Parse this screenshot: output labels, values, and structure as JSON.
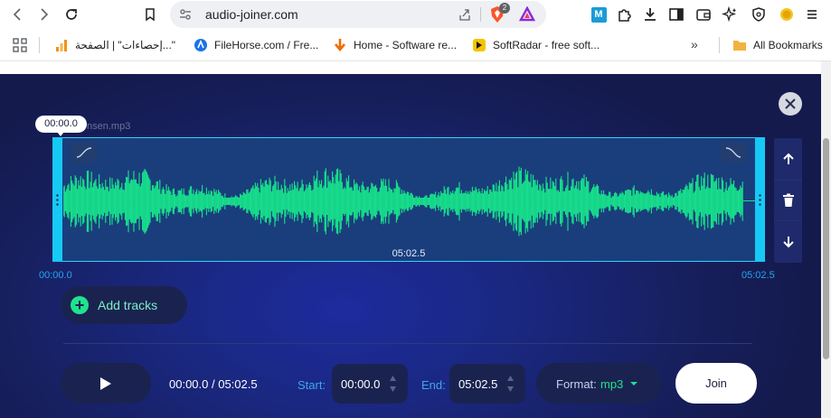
{
  "browser": {
    "url": "audio-joiner.com",
    "brave_badge_count": "2",
    "nav_icons": [
      "back-icon",
      "forward-icon",
      "reload-icon",
      "bookmark-icon"
    ],
    "extension_icons": [
      "m-icon",
      "puzzle-icon",
      "download-icon",
      "sidebar-icon",
      "wallet-icon",
      "sparkle-icon",
      "vpn-icon",
      "coin-icon"
    ],
    "extension_m_label": "M"
  },
  "bookmarks": {
    "items": [
      {
        "label": "إحصاءات\" | الصفحة...\"",
        "icon": "stats-favicon",
        "color": "#f09216"
      },
      {
        "label": "FileHorse.com / Fre...",
        "icon": "filehorse-favicon",
        "color": "#1a73e8"
      },
      {
        "label": "Home - Software re...",
        "icon": "arrow-down-favicon",
        "color": "#ef6c00"
      },
      {
        "label": "SoftRadar - free soft...",
        "icon": "softradar-favicon",
        "color": "#f5c400"
      }
    ],
    "more_label": "»",
    "all_bookmarks_label": "All Bookmarks"
  },
  "editor": {
    "playhead_time": "00:00.0",
    "file_name": "nsen.mp3",
    "duration": "05:02.5",
    "start_time_label": "00:00.0",
    "end_time_label": "05:02.5",
    "add_tracks_label": "Add tracks",
    "position_readout": "00:00.0 / 05:02.5",
    "start_label": "Start:",
    "start_value": "00:00.0",
    "end_label": "End:",
    "end_value": "05:02.5",
    "format_label": "Format:",
    "format_value": "mp3",
    "join_label": "Join",
    "colors": {
      "accent": "#1fe38d",
      "selection": "#17c9f5",
      "waveform": "#17e68c",
      "background": "#1a2882"
    }
  }
}
